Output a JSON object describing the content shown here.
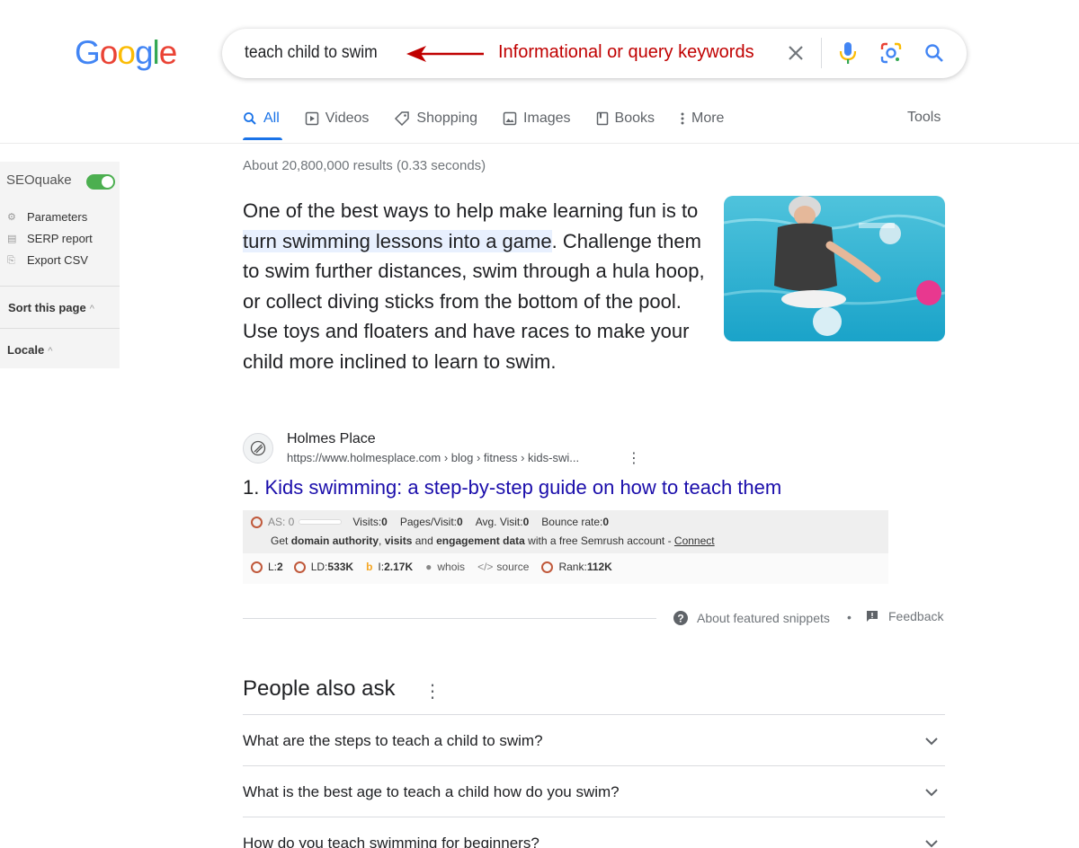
{
  "logo": {
    "letters": [
      "G",
      "o",
      "o",
      "g",
      "l",
      "e"
    ],
    "colors": [
      "#4285f4",
      "#ea4335",
      "#fbbc05",
      "#4285f4",
      "#34a853",
      "#ea4335"
    ]
  },
  "search": {
    "query": "teach child to swim",
    "annotation": "Informational or query keywords",
    "annotation_color": "#c00000"
  },
  "tabs": [
    {
      "label": "All",
      "icon": "search-icon",
      "active": true
    },
    {
      "label": "Videos",
      "icon": "video-icon"
    },
    {
      "label": "Shopping",
      "icon": "tag-icon"
    },
    {
      "label": "Images",
      "icon": "image-icon"
    },
    {
      "label": "Books",
      "icon": "book-icon"
    },
    {
      "label": "More",
      "icon": "more-vert-icon"
    }
  ],
  "tools_label": "Tools",
  "seoquake": {
    "title": "SEOquake",
    "toggle_on": true,
    "items": [
      {
        "label": "Parameters",
        "icon": "gear-icon"
      },
      {
        "label": "SERP report",
        "icon": "report-icon"
      },
      {
        "label": "Export CSV",
        "icon": "export-icon"
      }
    ],
    "sort_label": "Sort this page",
    "locale_label": "Locale"
  },
  "results_stats": "About 20,800,000 results (0.33 seconds)",
  "snippet": {
    "before": "One of the best ways to help make learning fun is to ",
    "highlight": "turn swimming lessons into a game",
    "after": ". Challenge them to swim further distances, swim through a hula hoop, or collect diving sticks from the bottom of the pool. Use toys and floaters and have races to make your child more inclined to learn to swim."
  },
  "result": {
    "site_name": "Holmes Place",
    "url": "https://www.holmesplace.com › blog › fitness › kids-swi...",
    "number": "1.",
    "title": "Kids swimming: a step-by-step guide on how to teach them"
  },
  "seoquake_bar": {
    "as_label": "AS: 0",
    "visits": "Visits: ",
    "visits_val": "0",
    "pages": "Pages/Visit: ",
    "pages_val": "0",
    "avg": "Avg. Visit: ",
    "avg_val": "0",
    "bounce": "Bounce rate: ",
    "bounce_val": "0",
    "promo_1": "Get ",
    "promo_b1": "domain authority",
    "promo_2": ", ",
    "promo_b2": "visits",
    "promo_3": " and ",
    "promo_b3": "engagement data",
    "promo_4": " with a free Semrush account - ",
    "connect": "Connect",
    "l_label": "L: ",
    "l_val": "2",
    "ld_label": "LD: ",
    "ld_val": "533K",
    "i_label": "I: ",
    "i_val": "2.17K",
    "whois": "whois",
    "source": "source",
    "rank_label": "Rank: ",
    "rank_val": "112K"
  },
  "featured_footer": {
    "about": "About featured snippets",
    "dot": "•",
    "feedback": "Feedback"
  },
  "paa": {
    "title": "People also ask",
    "questions": [
      "What are the steps to teach a child to swim?",
      "What is the best age to teach a child how do you swim?",
      "How do you teach swimming for beginners?"
    ]
  }
}
